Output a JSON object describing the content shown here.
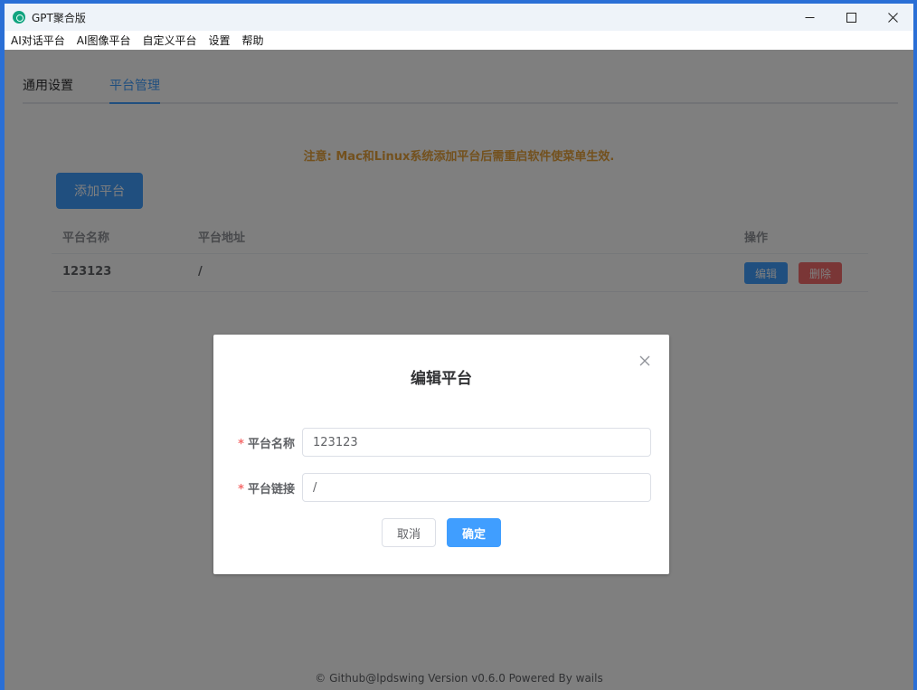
{
  "window": {
    "title": "GPT聚合版",
    "minimize_glyph": "–",
    "maximize_glyph": "☐",
    "close_glyph": "✕"
  },
  "menubar": {
    "items": [
      "AI对话平台",
      "AI图像平台",
      "自定义平台",
      "设置",
      "帮助"
    ]
  },
  "tabs": [
    {
      "label": "通用设置",
      "active": false
    },
    {
      "label": "平台管理",
      "active": true
    }
  ],
  "notice": "注意: Mac和Linux系统添加平台后需重启软件使菜单生效.",
  "add_button": "添加平台",
  "table": {
    "headers": {
      "name": "平台名称",
      "url": "平台地址",
      "actions": "操作"
    },
    "rows": [
      {
        "name": "123123",
        "url": "/",
        "edit": "编辑",
        "delete": "删除"
      }
    ]
  },
  "footer": "© Github@lpdswing Version v0.6.0 Powered By wails",
  "dialog": {
    "title": "编辑平台",
    "fields": {
      "name": {
        "required_mark": "*",
        "label": "平台名称",
        "value": "123123"
      },
      "link": {
        "required_mark": "*",
        "label": "平台链接",
        "value": "/"
      }
    },
    "cancel": "取消",
    "confirm": "确定"
  },
  "colors": {
    "primary": "#409eff",
    "danger": "#f56c6c",
    "warning": "#e6a23c",
    "app_icon": "#10a37f"
  }
}
